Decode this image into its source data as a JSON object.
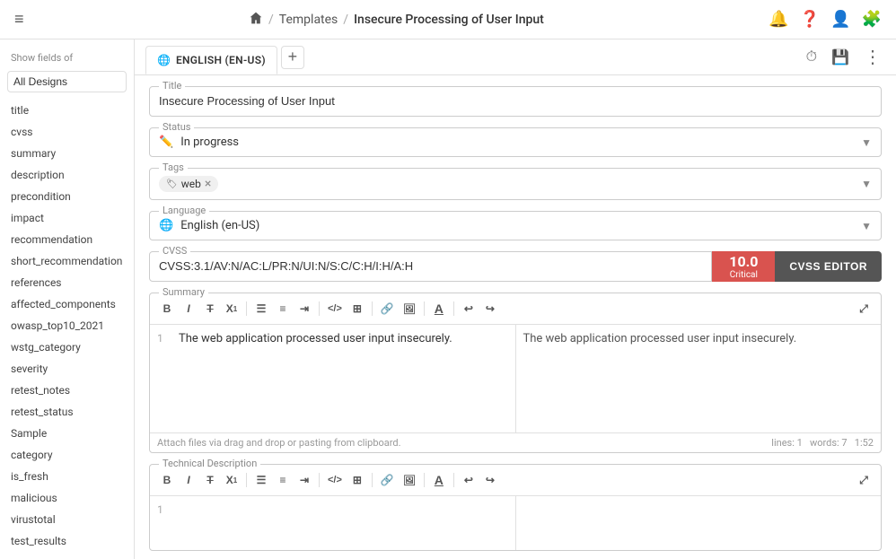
{
  "nav": {
    "home_label": "Home",
    "breadcrumb_sep": "/",
    "breadcrumb_templates": "Templates",
    "breadcrumb_page": "Insecure Processing of User Input"
  },
  "sidebar": {
    "show_fields_label": "Show fields of",
    "design_select": "All Designs",
    "items": [
      {
        "label": "title"
      },
      {
        "label": "cvss"
      },
      {
        "label": "summary"
      },
      {
        "label": "description"
      },
      {
        "label": "precondition"
      },
      {
        "label": "impact"
      },
      {
        "label": "recommendation"
      },
      {
        "label": "short_recommendation"
      },
      {
        "label": "references"
      },
      {
        "label": "affected_components"
      },
      {
        "label": "owasp_top10_2021"
      },
      {
        "label": "wstg_category"
      },
      {
        "label": "severity"
      },
      {
        "label": "retest_notes"
      },
      {
        "label": "retest_status"
      },
      {
        "label": "Sample"
      },
      {
        "label": "category"
      },
      {
        "label": "is_fresh"
      },
      {
        "label": "malicious"
      },
      {
        "label": "virustotal"
      },
      {
        "label": "test_results"
      }
    ]
  },
  "tab": {
    "lang_icon": "🌐",
    "label": "ENGLISH (EN-US)",
    "add_btn": "+"
  },
  "toolbar_actions": {
    "history_icon": "⏱",
    "save_icon": "💾",
    "more_icon": "⋮"
  },
  "fields": {
    "title_label": "Title",
    "title_value": "Insecure Processing of User Input",
    "status_label": "Status",
    "status_value": "In progress",
    "tags_label": "Tags",
    "tag_web": "web",
    "language_label": "Language",
    "language_value": "English (en-US)",
    "cvss_label": "CVSS",
    "cvss_value": "CVSS:3.1/AV:N/AC:L/PR:N/UI:N/S:C/C:H/I:H/A:H",
    "cvss_score": "10.0",
    "cvss_rating": "Critical",
    "cvss_editor_btn": "CVSS EDITOR",
    "summary_label": "Summary",
    "summary_line1": "The web application processed user input insecurely.",
    "summary_preview": "The web application processed user input insecurely.",
    "summary_footer_attach": "Attach files via drag and drop or pasting from clipboard.",
    "summary_footer_lines": "lines: 1",
    "summary_footer_words": "words: 7",
    "summary_footer_time": "1:52",
    "tech_desc_label": "Technical Description"
  },
  "toolbar_buttons": {
    "bold": "B",
    "italic": "I",
    "strikethrough": "T̶",
    "superscript": "X¹",
    "ul": "☰",
    "ol": "≡",
    "indent": "⇥",
    "code": "</>",
    "table": "⊞",
    "link": "🔗",
    "image": "🖼",
    "format": "A",
    "undo": "↩",
    "redo": "↪",
    "expand": "⤢"
  }
}
